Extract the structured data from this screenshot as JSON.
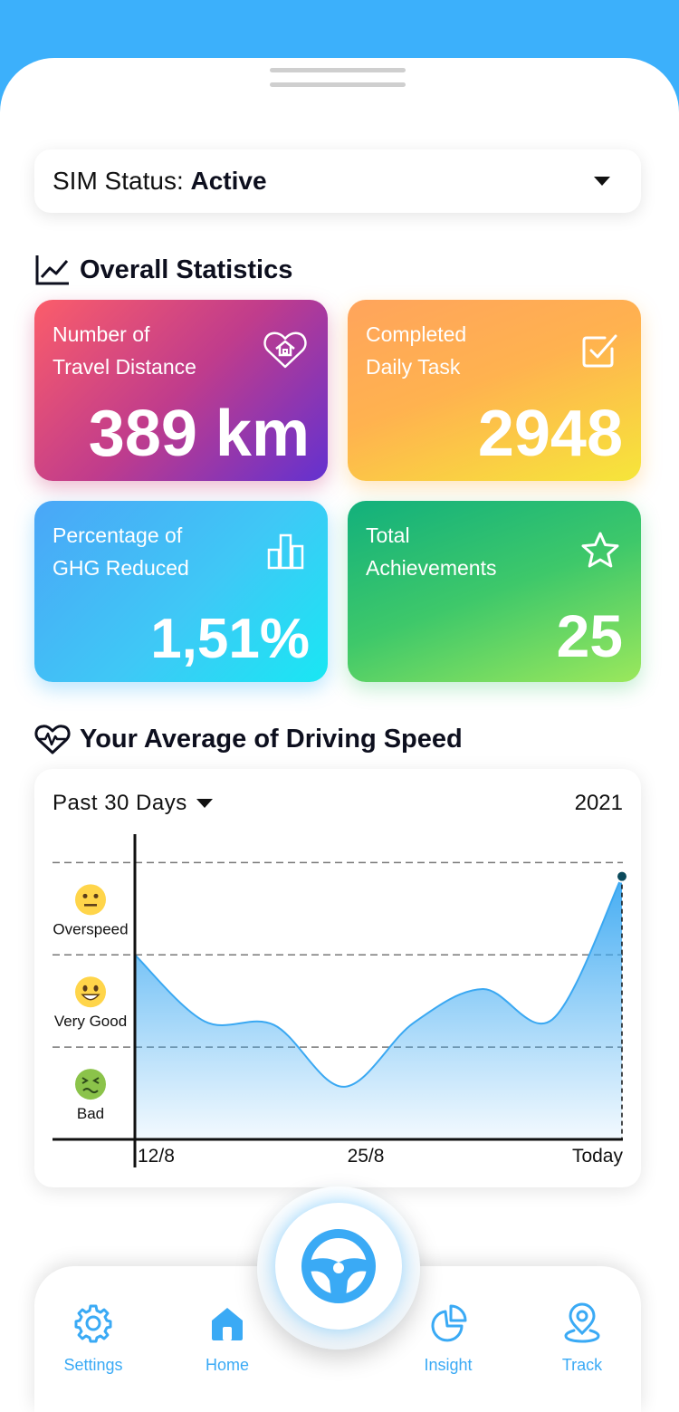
{
  "sim": {
    "label": "SIM Status:",
    "value": "Active"
  },
  "overall": {
    "title": "Overall Statistics",
    "cards": [
      {
        "line1": "Number of",
        "line2": "Travel Distance",
        "value": "389 km",
        "icon": "heart-home-icon"
      },
      {
        "line1": "Completed",
        "line2": "Daily Task",
        "value": "2948",
        "icon": "checkbox-icon"
      },
      {
        "line1": "Percentage of",
        "line2": "GHG Reduced",
        "value": "1,51%",
        "icon": "bar-chart-icon"
      },
      {
        "line1": "Total",
        "line2": "Achievements",
        "value": "25",
        "icon": "star-icon"
      }
    ]
  },
  "speed": {
    "title": "Your Average of Driving Speed",
    "range": "Past 30 Days",
    "year": "2021"
  },
  "chart_data": {
    "type": "area",
    "x_tick_labels": [
      "12/8",
      "25/8",
      "Today"
    ],
    "y_levels": [
      {
        "label": "Overspeed",
        "icon": "neutral-face-icon"
      },
      {
        "label": "Very Good",
        "icon": "smiling-face-icon"
      },
      {
        "label": "Bad",
        "icon": "sick-face-icon"
      }
    ],
    "y_scale": "Bad=1, Very Good=2, Overspeed=3",
    "series": [
      {
        "values": [
          2.0,
          1.28,
          1.24,
          0.57,
          1.26,
          1.63,
          1.3,
          2.85
        ]
      }
    ],
    "ylim": [
      0,
      3.2
    ],
    "grid": true,
    "colors": {
      "fill": "#3aa8f2",
      "line": "#3aa8f2",
      "marker": "#0b4a5c"
    }
  },
  "nav": {
    "items": [
      {
        "label": "Settings",
        "icon": "gear-icon"
      },
      {
        "label": "Home",
        "icon": "home-icon"
      },
      {
        "label": "Insight",
        "icon": "pie-chart-icon"
      },
      {
        "label": "Track",
        "icon": "location-pin-icon"
      }
    ],
    "center_icon": "steering-wheel-icon"
  },
  "colors": {
    "accent": "#3aaaf5",
    "header": "#3cb0fb"
  }
}
